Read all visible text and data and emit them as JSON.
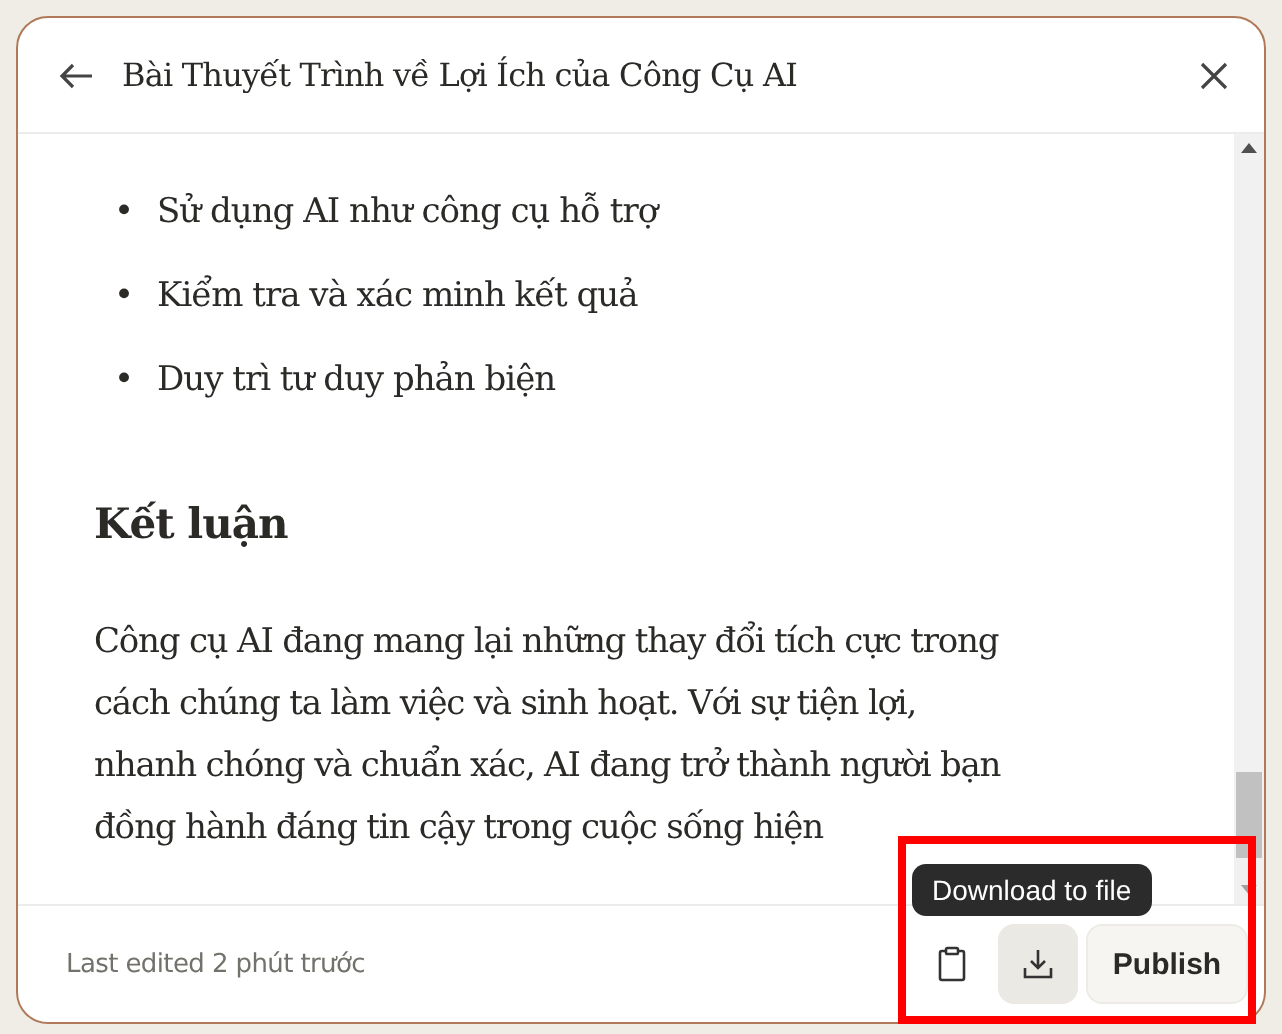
{
  "dialog": {
    "title": "Bài Thuyết Trình về Lợi Ích của Công Cụ AI"
  },
  "content": {
    "bullets": [
      {
        "marker": "•",
        "text": "Sử dụng AI như công cụ hỗ trợ"
      },
      {
        "marker": "•",
        "text": "Kiểm tra và xác minh kết quả"
      },
      {
        "marker": "•",
        "text": "Duy trì tư duy phản biện"
      }
    ],
    "heading": "Kết luận",
    "paragraph_lines": [
      "Công cụ AI đang mang lại những thay đổi tích cực trong",
      "cách chúng ta làm việc và sinh hoạt. Với sự tiện lợi,",
      "nhanh chóng và chuẩn xác, AI đang trở thành người bạn",
      "đồng hành đáng tin cậy trong cuộc sống hiện"
    ]
  },
  "footer": {
    "status": "Last edited 2 phút trước",
    "tooltip": "Download to file",
    "publish_label": "Publish"
  }
}
